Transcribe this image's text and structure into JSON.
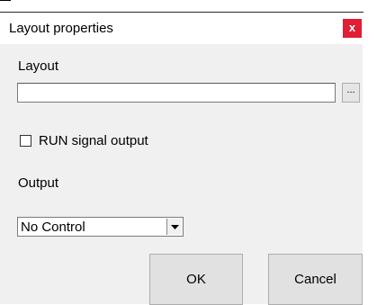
{
  "window": {
    "title": "Layout properties",
    "close_glyph": "x"
  },
  "layout": {
    "label": "Layout",
    "value": "",
    "browse_label": "..."
  },
  "run_signal": {
    "label": "RUN signal output",
    "checked": false
  },
  "output": {
    "label": "Output",
    "selected": "No Control"
  },
  "buttons": {
    "ok": "OK",
    "cancel": "Cancel"
  },
  "colors": {
    "dialog_bg": "#f0f0f0",
    "close_bg": "#e01e35",
    "button_bg": "#e1e1e1"
  }
}
